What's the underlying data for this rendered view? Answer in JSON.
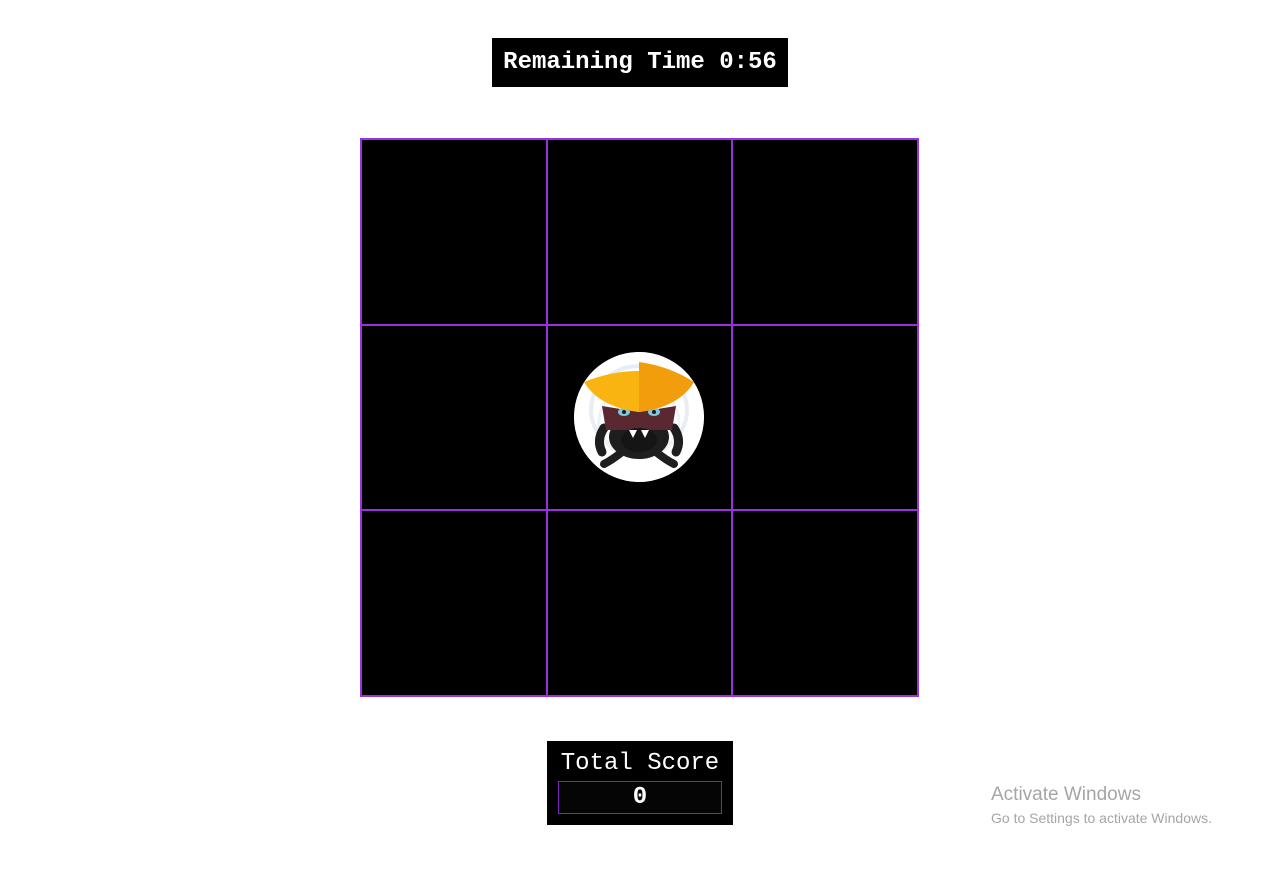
{
  "timer": {
    "label": "Remaining Time 0:56"
  },
  "board": {
    "rows": 3,
    "columns": 3,
    "mole_cell": 4,
    "colors": {
      "cell_background": "#000000",
      "grid_border": "#9b30e0"
    }
  },
  "score": {
    "label": "Total Score",
    "value": "0"
  },
  "watermark": {
    "title": "Activate Windows",
    "subtitle": "Go to Settings to activate Windows."
  }
}
